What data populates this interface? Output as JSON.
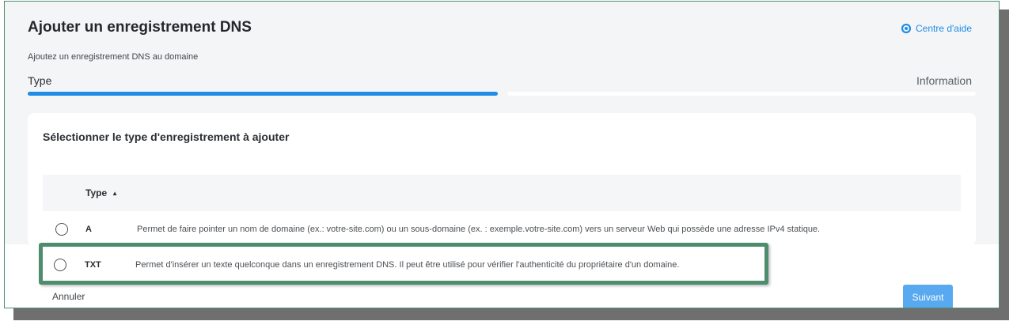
{
  "header": {
    "title": "Ajouter un enregistrement DNS",
    "help_label": "Centre d'aide",
    "help_icon": "help-circle-icon",
    "subtitle": "Ajoutez un enregistrement DNS au domaine"
  },
  "steps": {
    "items": [
      {
        "label": "Type",
        "active": true
      },
      {
        "label": "Information",
        "active": false
      }
    ]
  },
  "card": {
    "title": "Sélectionner le type d'enregistrement à ajouter",
    "table": {
      "column_header": "Type",
      "sort_icon": "sort-ascending-icon",
      "rows": [
        {
          "type": "A",
          "description": "Permet de faire pointer un nom de domaine (ex.: votre-site.com) ou un sous-domaine (ex. : exemple.votre-site.com) vers un serveur Web qui possède une adresse IPv4 statique.",
          "selected": false
        },
        {
          "type": "TXT",
          "description": "Permet d'insérer un texte quelconque dans un enregistrement DNS. Il peut être utilisé pour vérifier l'authenticité du propriétaire d'un domaine.",
          "selected": false,
          "highlighted": true
        }
      ]
    }
  },
  "footer": {
    "cancel_label": "Annuler",
    "next_label": "Suivant"
  },
  "colors": {
    "accent": "#1f8ce6",
    "highlight_border": "#4e8c6e",
    "next_button": "#58a9f0"
  }
}
